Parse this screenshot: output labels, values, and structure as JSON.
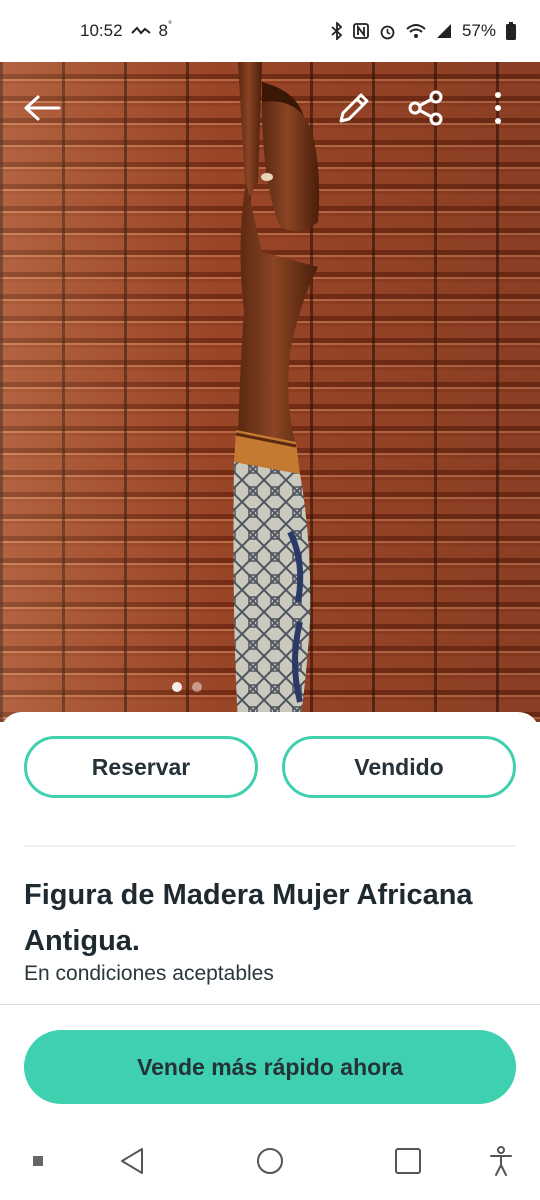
{
  "status_bar": {
    "time": "10:52",
    "extra_indicator": "8",
    "battery": "57%"
  },
  "toolbar": {
    "back_icon": "arrow-left-icon",
    "edit_icon": "pencil-icon",
    "share_icon": "share-icon",
    "more_icon": "more-vertical-icon"
  },
  "gallery": {
    "image_count_indicators": 2,
    "active_index": 0
  },
  "actions": {
    "reserve_label": "Reservar",
    "sold_label": "Vendido"
  },
  "product": {
    "title": "Figura de Madera Mujer Africana Antigua.",
    "condition": "En condiciones aceptables"
  },
  "cta": {
    "label": "Vende más rápido ahora"
  },
  "colors": {
    "accent": "#3fd0b0",
    "text": "#253238"
  },
  "nav_bar": {
    "items": [
      "recent-dot-icon",
      "back-triangle-icon",
      "home-circle-icon",
      "overview-square-icon",
      "accessibility-icon"
    ]
  }
}
